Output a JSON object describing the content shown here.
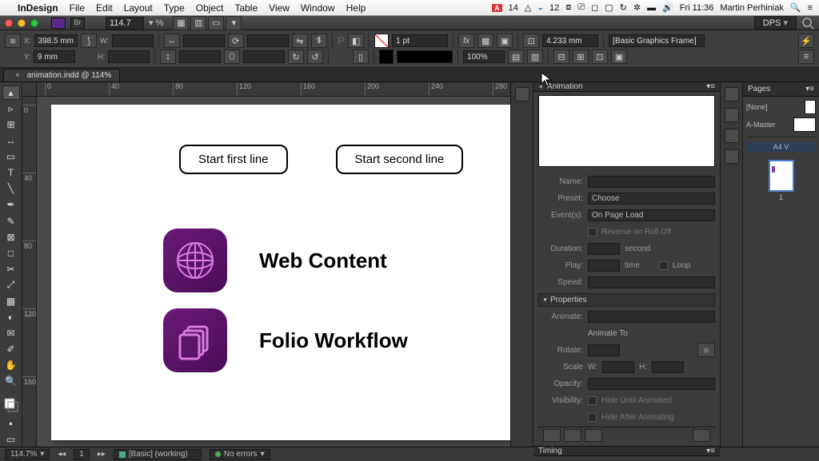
{
  "menubar": {
    "app": "InDesign",
    "menus": [
      "File",
      "Edit",
      "Layout",
      "Type",
      "Object",
      "Table",
      "View",
      "Window",
      "Help"
    ],
    "status": {
      "adobe_badge": "14",
      "cc_badge": "12",
      "time": "Fri 11:36",
      "user": "Martin Perhiniak"
    }
  },
  "titlebar": {
    "zoom": "114.7",
    "workspace_preset": "DPS"
  },
  "control_bar": {
    "x_field": "398.5 mm",
    "y_field": "9 mm",
    "stroke_weight": "1 pt",
    "scale": "100%",
    "measure": "4.233 mm",
    "style_label": "[Basic Graphics Frame]"
  },
  "document": {
    "tab_label": "animation.indd @ 114%"
  },
  "ruler_h": [
    "0",
    "40",
    "80",
    "120",
    "160",
    "200",
    "240",
    "280"
  ],
  "ruler_v": [
    "0",
    "40",
    "80",
    "120",
    "160"
  ],
  "canvas": {
    "btn1": "Start first line",
    "btn2": "Start second line",
    "label1": "Web Content",
    "label2": "Folio Workflow"
  },
  "animation": {
    "title": "Animation",
    "name_lbl": "Name:",
    "preset_lbl": "Preset:",
    "preset_val": "Choose",
    "events_lbl": "Event(s):",
    "events_val": "On Page Load",
    "reverse_lbl": "Reverse on Roll Off",
    "duration_lbl": "Duration:",
    "duration_unit": "second",
    "play_lbl": "Play:",
    "play_unit": "time",
    "loop_lbl": "Loop",
    "speed_lbl": "Speed:",
    "properties": "Properties",
    "animate_lbl": "Animate:",
    "animate_to": "Animate To",
    "rotate_lbl": "Rotate:",
    "scale_lbl": "Scale",
    "scale_w": "W:",
    "scale_h": "H:",
    "opacity_lbl": "Opacity:",
    "visibility_lbl": "Visibility:",
    "hide_until": "Hide Until Animated",
    "hide_after": "Hide After Animating",
    "timing": "Timing"
  },
  "pages": {
    "title": "Pages",
    "none": "[None]",
    "master": "A-Master",
    "current": "A4 V",
    "page_num": "1"
  },
  "status": {
    "zoom": "114.7%",
    "spread": "1",
    "profile": "[Basic] (working)",
    "errors": "No errors"
  }
}
